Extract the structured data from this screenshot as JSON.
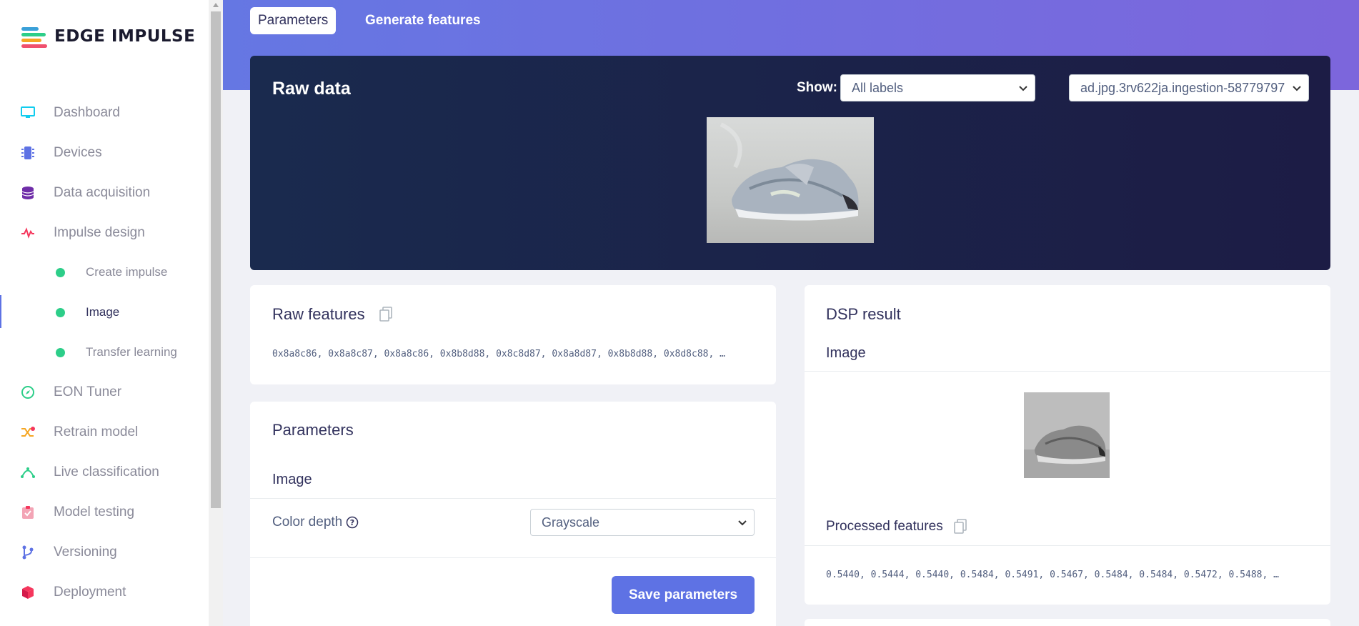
{
  "brand": {
    "name": "EDGE IMPULSE"
  },
  "sidebar": {
    "items": [
      {
        "label": "Dashboard",
        "icon": "monitor-icon"
      },
      {
        "label": "Devices",
        "icon": "chip-icon"
      },
      {
        "label": "Data acquisition",
        "icon": "database-icon"
      },
      {
        "label": "Impulse design",
        "icon": "pulse-icon"
      },
      {
        "label": "Create impulse",
        "icon": "dot-icon"
      },
      {
        "label": "Image",
        "icon": "dot-icon"
      },
      {
        "label": "Transfer learning",
        "icon": "dot-icon"
      },
      {
        "label": "EON Tuner",
        "icon": "compass-icon"
      },
      {
        "label": "Retrain model",
        "icon": "shuffle-icon"
      },
      {
        "label": "Live classification",
        "icon": "bezier-icon"
      },
      {
        "label": "Model testing",
        "icon": "clipboard-check-icon"
      },
      {
        "label": "Versioning",
        "icon": "branch-icon"
      },
      {
        "label": "Deployment",
        "icon": "cube-icon"
      }
    ]
  },
  "tabs": [
    {
      "label": "Parameters"
    },
    {
      "label": "Generate features"
    }
  ],
  "raw_data": {
    "title": "Raw data",
    "show_label": "Show:",
    "label_filter": "All labels",
    "sample": "ad.jpg.3rv622ja.ingestion-58779797"
  },
  "raw_features": {
    "title": "Raw features",
    "values": "0x8a8c86, 0x8a8c87, 0x8a8c86, 0x8b8d88, 0x8c8d87, 0x8a8d87, 0x8b8d88, 0x8d8c88, …"
  },
  "parameters": {
    "title": "Parameters",
    "section": "Image",
    "color_depth_label": "Color depth",
    "color_depth_value": "Grayscale",
    "save_label": "Save parameters"
  },
  "dsp_result": {
    "title": "DSP result",
    "section": "Image",
    "processed_title": "Processed features",
    "values": "0.5440, 0.5444, 0.5440, 0.5484, 0.5491, 0.5467, 0.5484, 0.5484, 0.5472, 0.5488, …"
  },
  "colors": {
    "accent": "#5e72e4",
    "active_dot": "#2dce89",
    "panel_dark": "#1a2a4e"
  }
}
